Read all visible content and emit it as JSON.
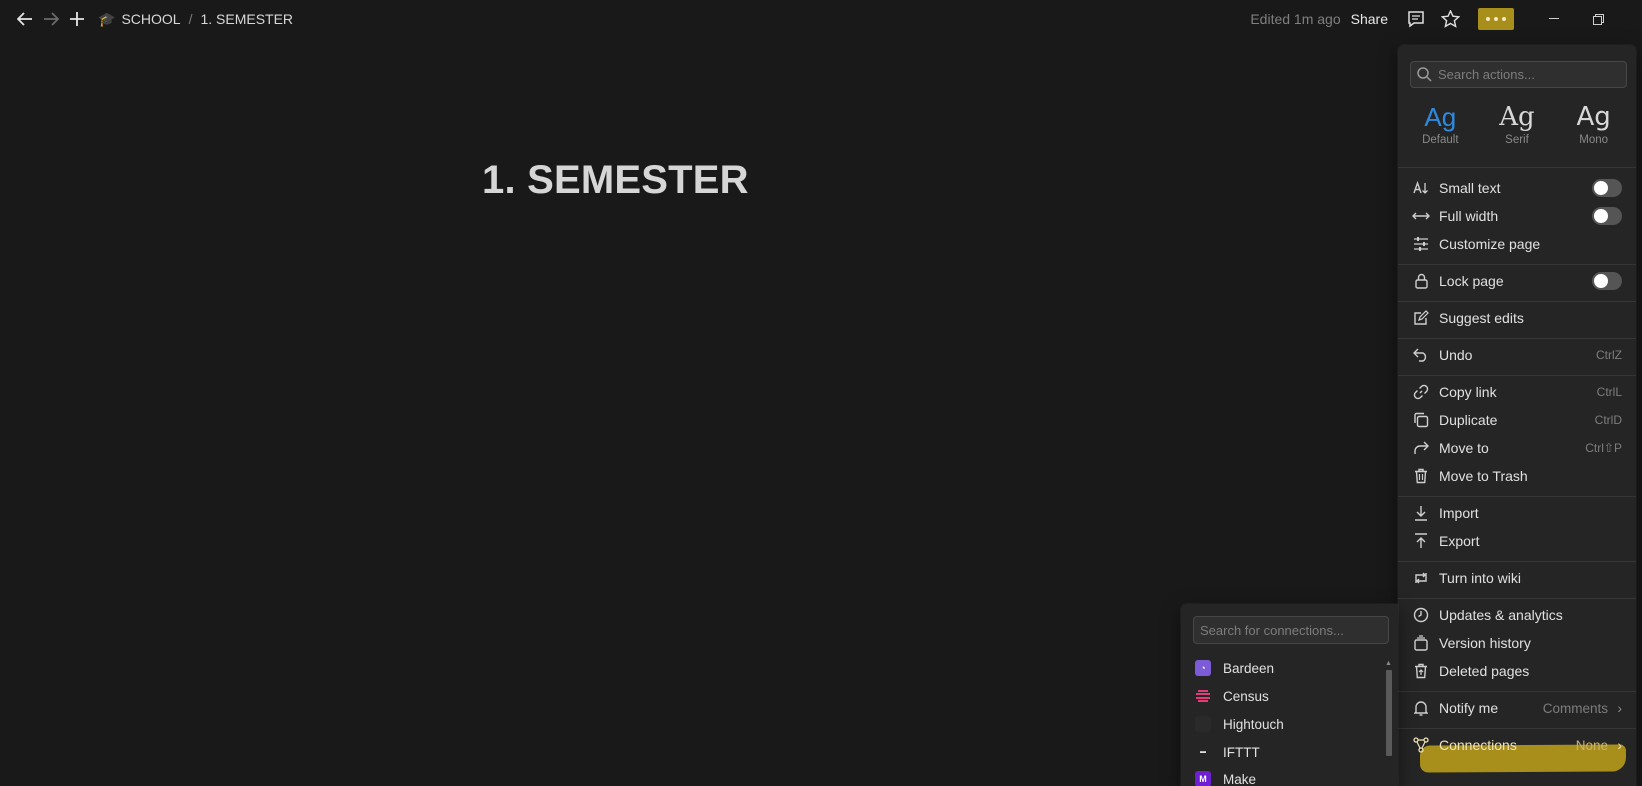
{
  "topbar": {
    "back_icon": "arrow-left-icon",
    "forward_icon": "arrow-right-icon",
    "new_icon": "plus-icon",
    "breadcrumb": [
      "SCHOOL",
      "1. SEMESTER"
    ],
    "separator": "/",
    "edited": "Edited 1m ago",
    "share": "Share",
    "comments_icon": "comment-icon",
    "favorite_icon": "star-icon",
    "more_icon": "more-dots-icon",
    "minimize_icon": "minimize-icon",
    "restore_icon": "restore-icon",
    "accent": "#a88f1b"
  },
  "page": {
    "title": "1. SEMESTER"
  },
  "menu": {
    "search_placeholder": "Search actions...",
    "fonts": [
      {
        "glyph": "Ag",
        "label": "Default",
        "selected": true
      },
      {
        "glyph": "Ag",
        "label": "Serif",
        "selected": false
      },
      {
        "glyph": "Ag",
        "label": "Mono",
        "selected": false
      }
    ],
    "selected_font_color": "#2d8ae0",
    "items": {
      "small_text": "Small text",
      "full_width": "Full width",
      "customize": "Customize page",
      "lock": "Lock page",
      "suggest": "Suggest edits",
      "undo": "Undo",
      "undo_sc": "CtrlZ",
      "copy_link": "Copy link",
      "copy_link_sc": "CtrlL",
      "duplicate": "Duplicate",
      "duplicate_sc": "CtrlD",
      "move_to": "Move to",
      "move_to_sc": "Ctrl⇧P",
      "trash": "Move to Trash",
      "import": "Import",
      "export": "Export",
      "wiki": "Turn into wiki",
      "updates": "Updates & analytics",
      "version": "Version history",
      "deleted": "Deleted pages",
      "notify": "Notify me",
      "notify_val": "Comments",
      "connections": "Connections",
      "connections_val": "None"
    },
    "toggles": {
      "small_text": false,
      "full_width": false,
      "lock": false
    }
  },
  "connections": {
    "search_placeholder": "Search for connections...",
    "items": [
      {
        "name": "Bardeen",
        "color": "#7b5cd6"
      },
      {
        "name": "Census",
        "color": "#e23b7a"
      },
      {
        "name": "Hightouch",
        "color": "#2a2a2a"
      },
      {
        "name": "IFTTT",
        "color": "#222222"
      },
      {
        "name": "Make",
        "color": "#6d1fd1"
      }
    ]
  }
}
